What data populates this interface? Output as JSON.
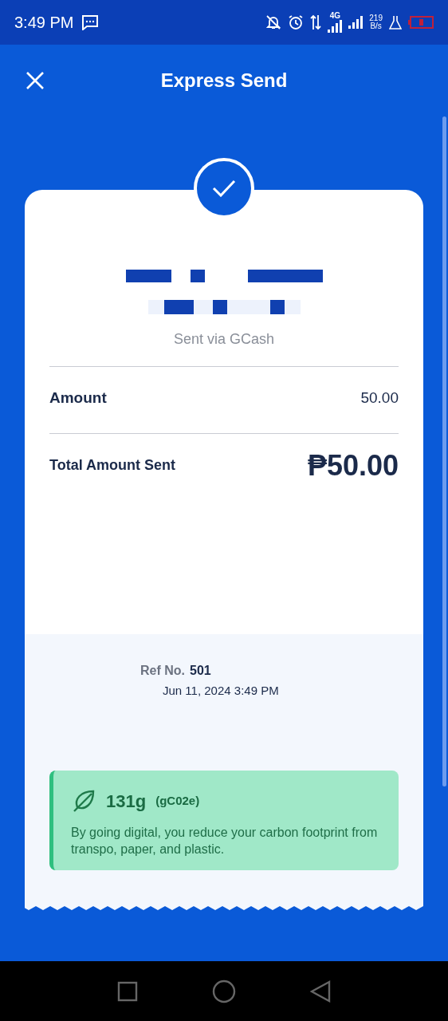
{
  "status_bar": {
    "time": "3:49 PM",
    "network_type": "4G",
    "speed_value": "219",
    "speed_unit": "B/s"
  },
  "header": {
    "title": "Express Send"
  },
  "receipt": {
    "sent_via": "Sent via GCash",
    "rows": [
      {
        "label": "Amount",
        "value": "50.00",
        "kind": "plain"
      },
      {
        "label": "Total Amount Sent",
        "value": "₱50.00",
        "kind": "total"
      }
    ],
    "ref_label": "Ref No.",
    "ref_value": "501",
    "date": "Jun 11, 2024 3:49 PM",
    "carbon": {
      "amount": "131g",
      "unit": "(gC02e)",
      "message": "By going digital, you reduce your carbon footprint from transpo, paper, and plastic."
    }
  }
}
